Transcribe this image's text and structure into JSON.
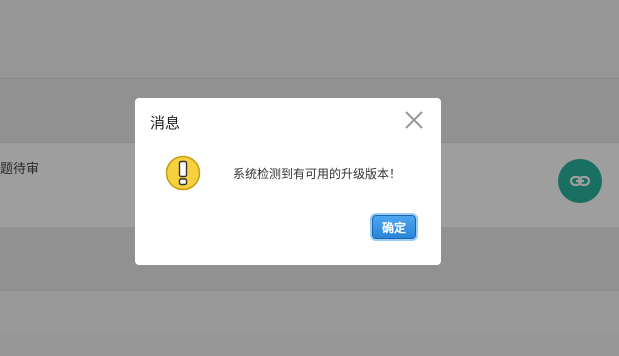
{
  "background": {
    "row_text": "题待审",
    "link_button_icon": "link-icon"
  },
  "dialog": {
    "title": "消息",
    "close_icon": "close-icon",
    "warning_icon": "warning-icon",
    "message": "系统检测到有可用的升级版本！",
    "confirm_label": "确定"
  },
  "colors": {
    "overlay": "#000000",
    "fab": "#2bb3a0",
    "confirm_button": "#2a85d8",
    "warning_fill": "#f7d23e"
  }
}
